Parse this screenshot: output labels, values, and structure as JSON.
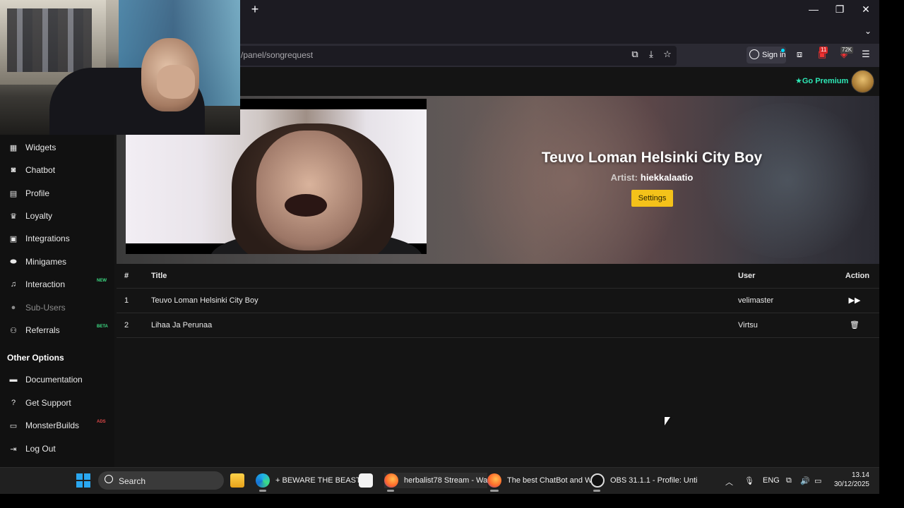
{
  "browser": {
    "url": "/panel/songrequest",
    "signin_label": "Sign in",
    "ext_badges": [
      "11",
      "72K"
    ],
    "window_controls": {
      "minimize": "—",
      "restore": "❐",
      "close": "✕"
    },
    "new_tab": "+",
    "tab_list": "⌄"
  },
  "header": {
    "premium_label": "Go Premium",
    "premium_color": "#2ee8b6"
  },
  "sidebar": {
    "items": [
      {
        "label": "Widgets",
        "icon": "grid-icon"
      },
      {
        "label": "Chatbot",
        "icon": "robot-icon"
      },
      {
        "label": "Profile",
        "icon": "id-card-icon"
      },
      {
        "label": "Loyalty",
        "icon": "trophy-icon"
      },
      {
        "label": "Integrations",
        "icon": "plug-icon"
      },
      {
        "label": "Minigames",
        "icon": "gamepad-icon"
      },
      {
        "label": "Interaction",
        "icon": "music-icon",
        "badge": "NEW",
        "badge_color": "#3ddc84"
      },
      {
        "label": "Sub-Users",
        "icon": "user-icon",
        "disabled": true
      },
      {
        "label": "Referrals",
        "icon": "users-icon",
        "badge": "BETA",
        "badge_color": "#3ddc84"
      }
    ],
    "other_heading": "Other Options",
    "other_items": [
      {
        "label": "Documentation",
        "icon": "book-icon"
      },
      {
        "label": "Get Support",
        "icon": "question-icon"
      },
      {
        "label": "MonsterBuilds",
        "icon": "laptop-icon",
        "badge": "ADS",
        "badge_color": "#e04848"
      },
      {
        "label": "Log Out",
        "icon": "logout-icon"
      }
    ]
  },
  "now_playing": {
    "title": "Teuvo Loman Helsinki City Boy",
    "artist_label": "Artist:",
    "artist": "hiekkalaatio",
    "settings_label": "Settings",
    "settings_color": "#f4c21a"
  },
  "queue": {
    "headers": {
      "num": "#",
      "title": "Title",
      "user": "User",
      "action": "Action"
    },
    "rows": [
      {
        "num": "1",
        "title": "Teuvo Loman Helsinki City Boy",
        "user": "velimaster",
        "action_icon": "skip-forward-icon"
      },
      {
        "num": "2",
        "title": "Lihaa Ja Perunaa",
        "user": "Virtsu",
        "action_icon": "trash-icon"
      }
    ]
  },
  "taskbar": {
    "search_label": "Search",
    "apps": [
      {
        "label": "+ BEWARE THE BEAST - I",
        "icon": "edge-icon"
      },
      {
        "label": "herbalist78 Stream - Wa",
        "icon": "firefox-icon"
      },
      {
        "label": "The best ChatBot and W",
        "icon": "firefox-icon"
      },
      {
        "label": "OBS 31.1.1 - Profile: Unti",
        "icon": "obs-icon"
      }
    ],
    "language": "ENG",
    "time": "13.14",
    "date": "30/12/2025"
  }
}
